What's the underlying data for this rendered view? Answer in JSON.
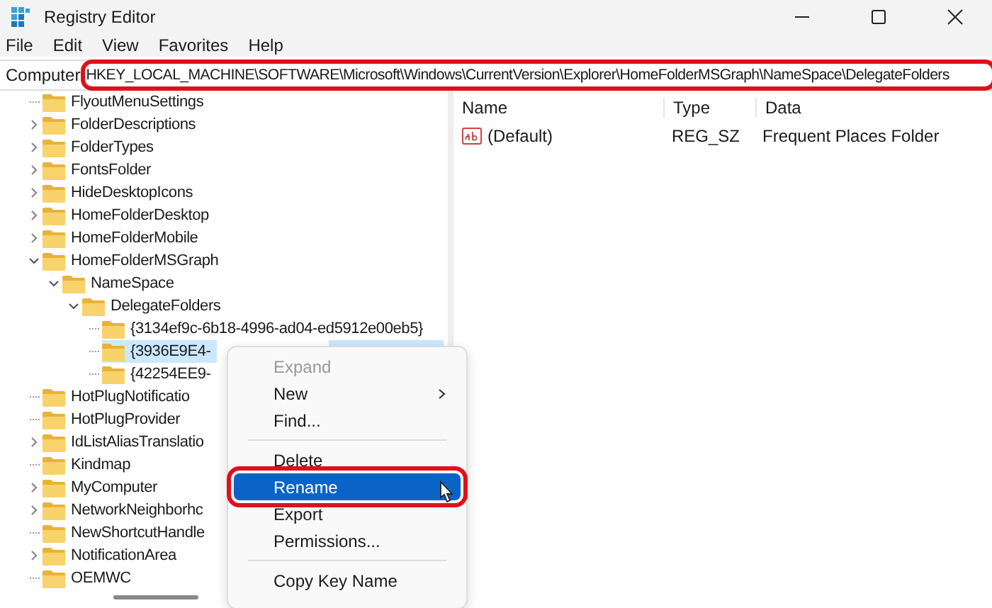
{
  "window": {
    "title": "Registry Editor"
  },
  "menu_bar": [
    "File",
    "Edit",
    "View",
    "Favorites",
    "Help"
  ],
  "address_bar": {
    "label": "Computer",
    "value": "HKEY_LOCAL_MACHINE\\SOFTWARE\\Microsoft\\Windows\\CurrentVersion\\Explorer\\HomeFolderMSGraph\\NameSpace\\DelegateFolders",
    "highlighted": true
  },
  "tree": [
    {
      "label": "FlyoutMenuSettings",
      "expandable": false,
      "selected": false
    },
    {
      "label": "FolderDescriptions",
      "expandable": true,
      "expanded": false,
      "selected": false
    },
    {
      "label": "FolderTypes",
      "expandable": true,
      "expanded": false,
      "selected": false
    },
    {
      "label": "FontsFolder",
      "expandable": true,
      "expanded": false,
      "selected": false
    },
    {
      "label": "HideDesktopIcons",
      "expandable": true,
      "expanded": false,
      "selected": false
    },
    {
      "label": "HomeFolderDesktop",
      "expandable": true,
      "expanded": false,
      "selected": false
    },
    {
      "label": "HomeFolderMobile",
      "expandable": true,
      "expanded": false,
      "selected": false
    },
    {
      "label": "HomeFolderMSGraph",
      "expandable": true,
      "expanded": true,
      "selected": false,
      "children": [
        {
          "label": "NameSpace",
          "expandable": true,
          "expanded": true,
          "selected": false,
          "children": [
            {
              "label": "DelegateFolders",
              "expandable": true,
              "expanded": true,
              "selected": false,
              "children": [
                {
                  "label": "{3134ef9c-6b18-4996-ad04-ed5912e00eb5}",
                  "expandable": false,
                  "selected": false
                },
                {
                  "label": "{3936E9E4-",
                  "expandable": false,
                  "selected": true
                },
                {
                  "label": "{42254EE9-",
                  "expandable": false,
                  "selected": false
                }
              ]
            }
          ]
        }
      ]
    },
    {
      "label": "HotPlugNotificatio",
      "expandable": false,
      "selected": false
    },
    {
      "label": "HotPlugProvider",
      "expandable": false,
      "selected": false
    },
    {
      "label": "IdListAliasTranslatio",
      "expandable": true,
      "expanded": false,
      "selected": false
    },
    {
      "label": "Kindmap",
      "expandable": false,
      "selected": false
    },
    {
      "label": "MyComputer",
      "expandable": true,
      "expanded": false,
      "selected": false
    },
    {
      "label": "NetworkNeighborhc",
      "expandable": true,
      "expanded": false,
      "selected": false
    },
    {
      "label": "NewShortcutHandle",
      "expandable": false,
      "selected": false
    },
    {
      "label": "NotificationArea",
      "expandable": true,
      "expanded": false,
      "selected": false
    },
    {
      "label": "OEMWC",
      "expandable": false,
      "selected": false
    }
  ],
  "values_table": {
    "columns": [
      "Name",
      "Type",
      "Data"
    ],
    "rows": [
      {
        "name": "(Default)",
        "type": "REG_SZ",
        "data": "Frequent Places Folder"
      }
    ]
  },
  "context_menu": [
    {
      "kind": "item",
      "label": "Expand",
      "disabled": true,
      "submenu": false,
      "selected": false,
      "highlighted": false
    },
    {
      "kind": "item",
      "label": "New",
      "disabled": false,
      "submenu": true,
      "selected": false,
      "highlighted": false
    },
    {
      "kind": "item",
      "label": "Find...",
      "disabled": false,
      "submenu": false,
      "selected": false,
      "highlighted": false
    },
    {
      "kind": "separator"
    },
    {
      "kind": "item",
      "label": "Delete",
      "disabled": false,
      "submenu": false,
      "selected": false,
      "highlighted": false
    },
    {
      "kind": "item",
      "label": "Rename",
      "disabled": false,
      "submenu": false,
      "selected": true,
      "highlighted": true
    },
    {
      "kind": "item",
      "label": "Export",
      "disabled": false,
      "submenu": false,
      "selected": false,
      "highlighted": false
    },
    {
      "kind": "item",
      "label": "Permissions...",
      "disabled": false,
      "submenu": false,
      "selected": false,
      "highlighted": false
    },
    {
      "kind": "separator"
    },
    {
      "kind": "item",
      "label": "Copy Key Name",
      "disabled": false,
      "submenu": false,
      "selected": false,
      "highlighted": false
    }
  ]
}
